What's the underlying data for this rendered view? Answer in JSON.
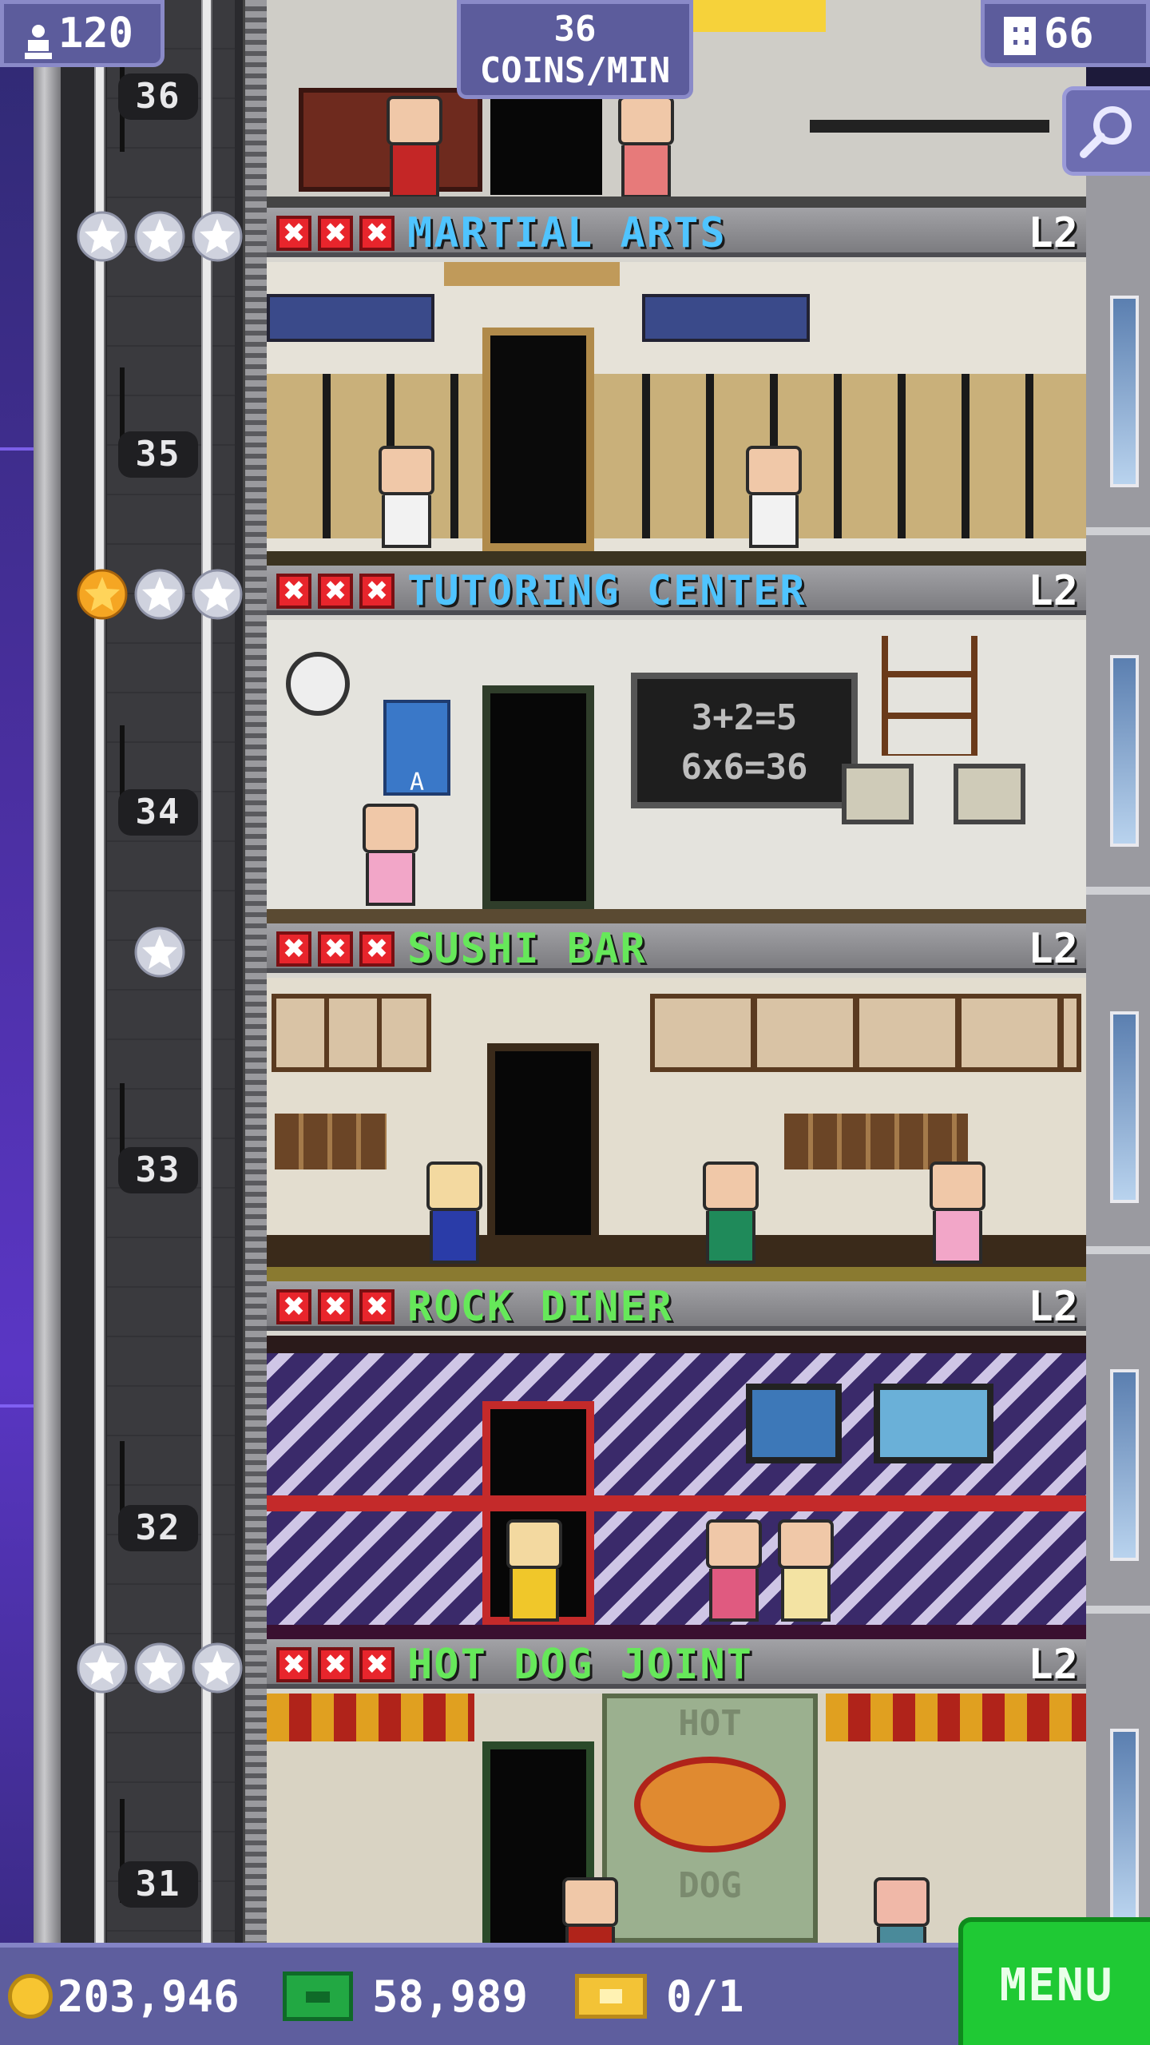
{
  "hud": {
    "population": "120",
    "coins_per_min_value": "36",
    "coins_per_min_label": "COINS/MIN",
    "floors": "66"
  },
  "floors": [
    {
      "number": "36",
      "name": "",
      "level": ""
    },
    {
      "number": "35",
      "name": "MARTIAL ARTS",
      "level": "L2",
      "name_color": "#4fc4ff",
      "stars_filled": 0,
      "stars_total": 3
    },
    {
      "number": "34",
      "name": "TUTORING CENTER",
      "level": "L2",
      "name_color": "#4fc4ff",
      "stars_filled": 1,
      "stars_total": 3
    },
    {
      "number": "33",
      "name": "SUSHI BAR",
      "level": "L2",
      "name_color": "#66e85a",
      "stars_filled": 0,
      "stars_total": 1
    },
    {
      "number": "32",
      "name": "ROCK DINER",
      "level": "L2",
      "name_color": "#66e85a",
      "stars_filled": 0,
      "stars_total": 0
    },
    {
      "number": "31",
      "name": "HOT DOG JOINT",
      "level": "L2",
      "name_color": "#66e85a",
      "stars_filled": 0,
      "stars_total": 3
    }
  ],
  "room_text": {
    "chalkboard_line1": "3+2=5",
    "chalkboard_line2": "6x6=36",
    "poster_letter": "A",
    "hotdog_sign_top": "HOT",
    "hotdog_sign_bottom": "DOG"
  },
  "bottom_bar": {
    "coins": "203,946",
    "bux": "58,989",
    "tickets": "0/1",
    "menu_label": "MENU"
  },
  "icons": [
    "population-icon",
    "floors-icon",
    "search-icon",
    "coin-icon",
    "bux-icon",
    "ticket-icon",
    "star-icon",
    "close-x-icon"
  ],
  "colors": {
    "hud_bg": "#5c5c9c",
    "menu_green": "#1fc934",
    "star_gold": "#f5a623",
    "star_silver": "#e6e6ee",
    "x_red": "#e8252c"
  }
}
